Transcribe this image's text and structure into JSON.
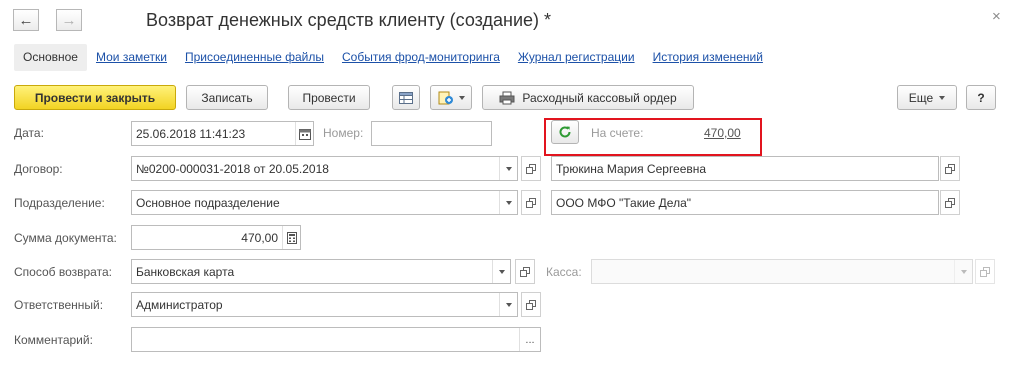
{
  "window": {
    "title": "Возврат денежных средств клиенту (создание) *",
    "close_glyph": "×",
    "nav": {
      "back_glyph": "←",
      "forward_glyph": "→"
    }
  },
  "tabs": [
    {
      "label": "Основное",
      "active": true
    },
    {
      "label": "Мои заметки"
    },
    {
      "label": "Присоединенные файлы"
    },
    {
      "label": "События фрод-мониторинга"
    },
    {
      "label": "Журнал регистрации"
    },
    {
      "label": "История изменений"
    }
  ],
  "toolbar": {
    "post_close": "Провести и закрыть",
    "save": "Записать",
    "post": "Провести",
    "cash_order": "Расходный кассовый ордер",
    "more": "Еще",
    "help": "?"
  },
  "form": {
    "date": {
      "label": "Дата:",
      "value": "25.06.2018 11:41:23"
    },
    "number": {
      "label": "Номер:",
      "value": ""
    },
    "balance": {
      "label": "На счете:",
      "value": "470,00"
    },
    "contract": {
      "label": "Договор:",
      "value": "№0200-000031-2018 от 20.05.2018"
    },
    "client": {
      "value": "Трюкина Мария Сергеевна"
    },
    "department": {
      "label": "Подразделение:",
      "value": "Основное подразделение"
    },
    "organization": {
      "value": "ООО МФО \"Такие Дела\""
    },
    "amount": {
      "label": "Сумма документа:",
      "value": "470,00"
    },
    "method": {
      "label": "Способ возврата:",
      "value": "Банковская карта"
    },
    "cashbox": {
      "label": "Касса:",
      "value": ""
    },
    "responsible": {
      "label": "Ответственный:",
      "value": "Администратор"
    },
    "comment": {
      "label": "Комментарий:",
      "value": "",
      "select_glyph": "..."
    }
  },
  "colors": {
    "accent_highlight": "#e2141e",
    "primary_button": "#f2d323",
    "link": "#1c51a8",
    "refresh_icon": "#2e9a33"
  }
}
